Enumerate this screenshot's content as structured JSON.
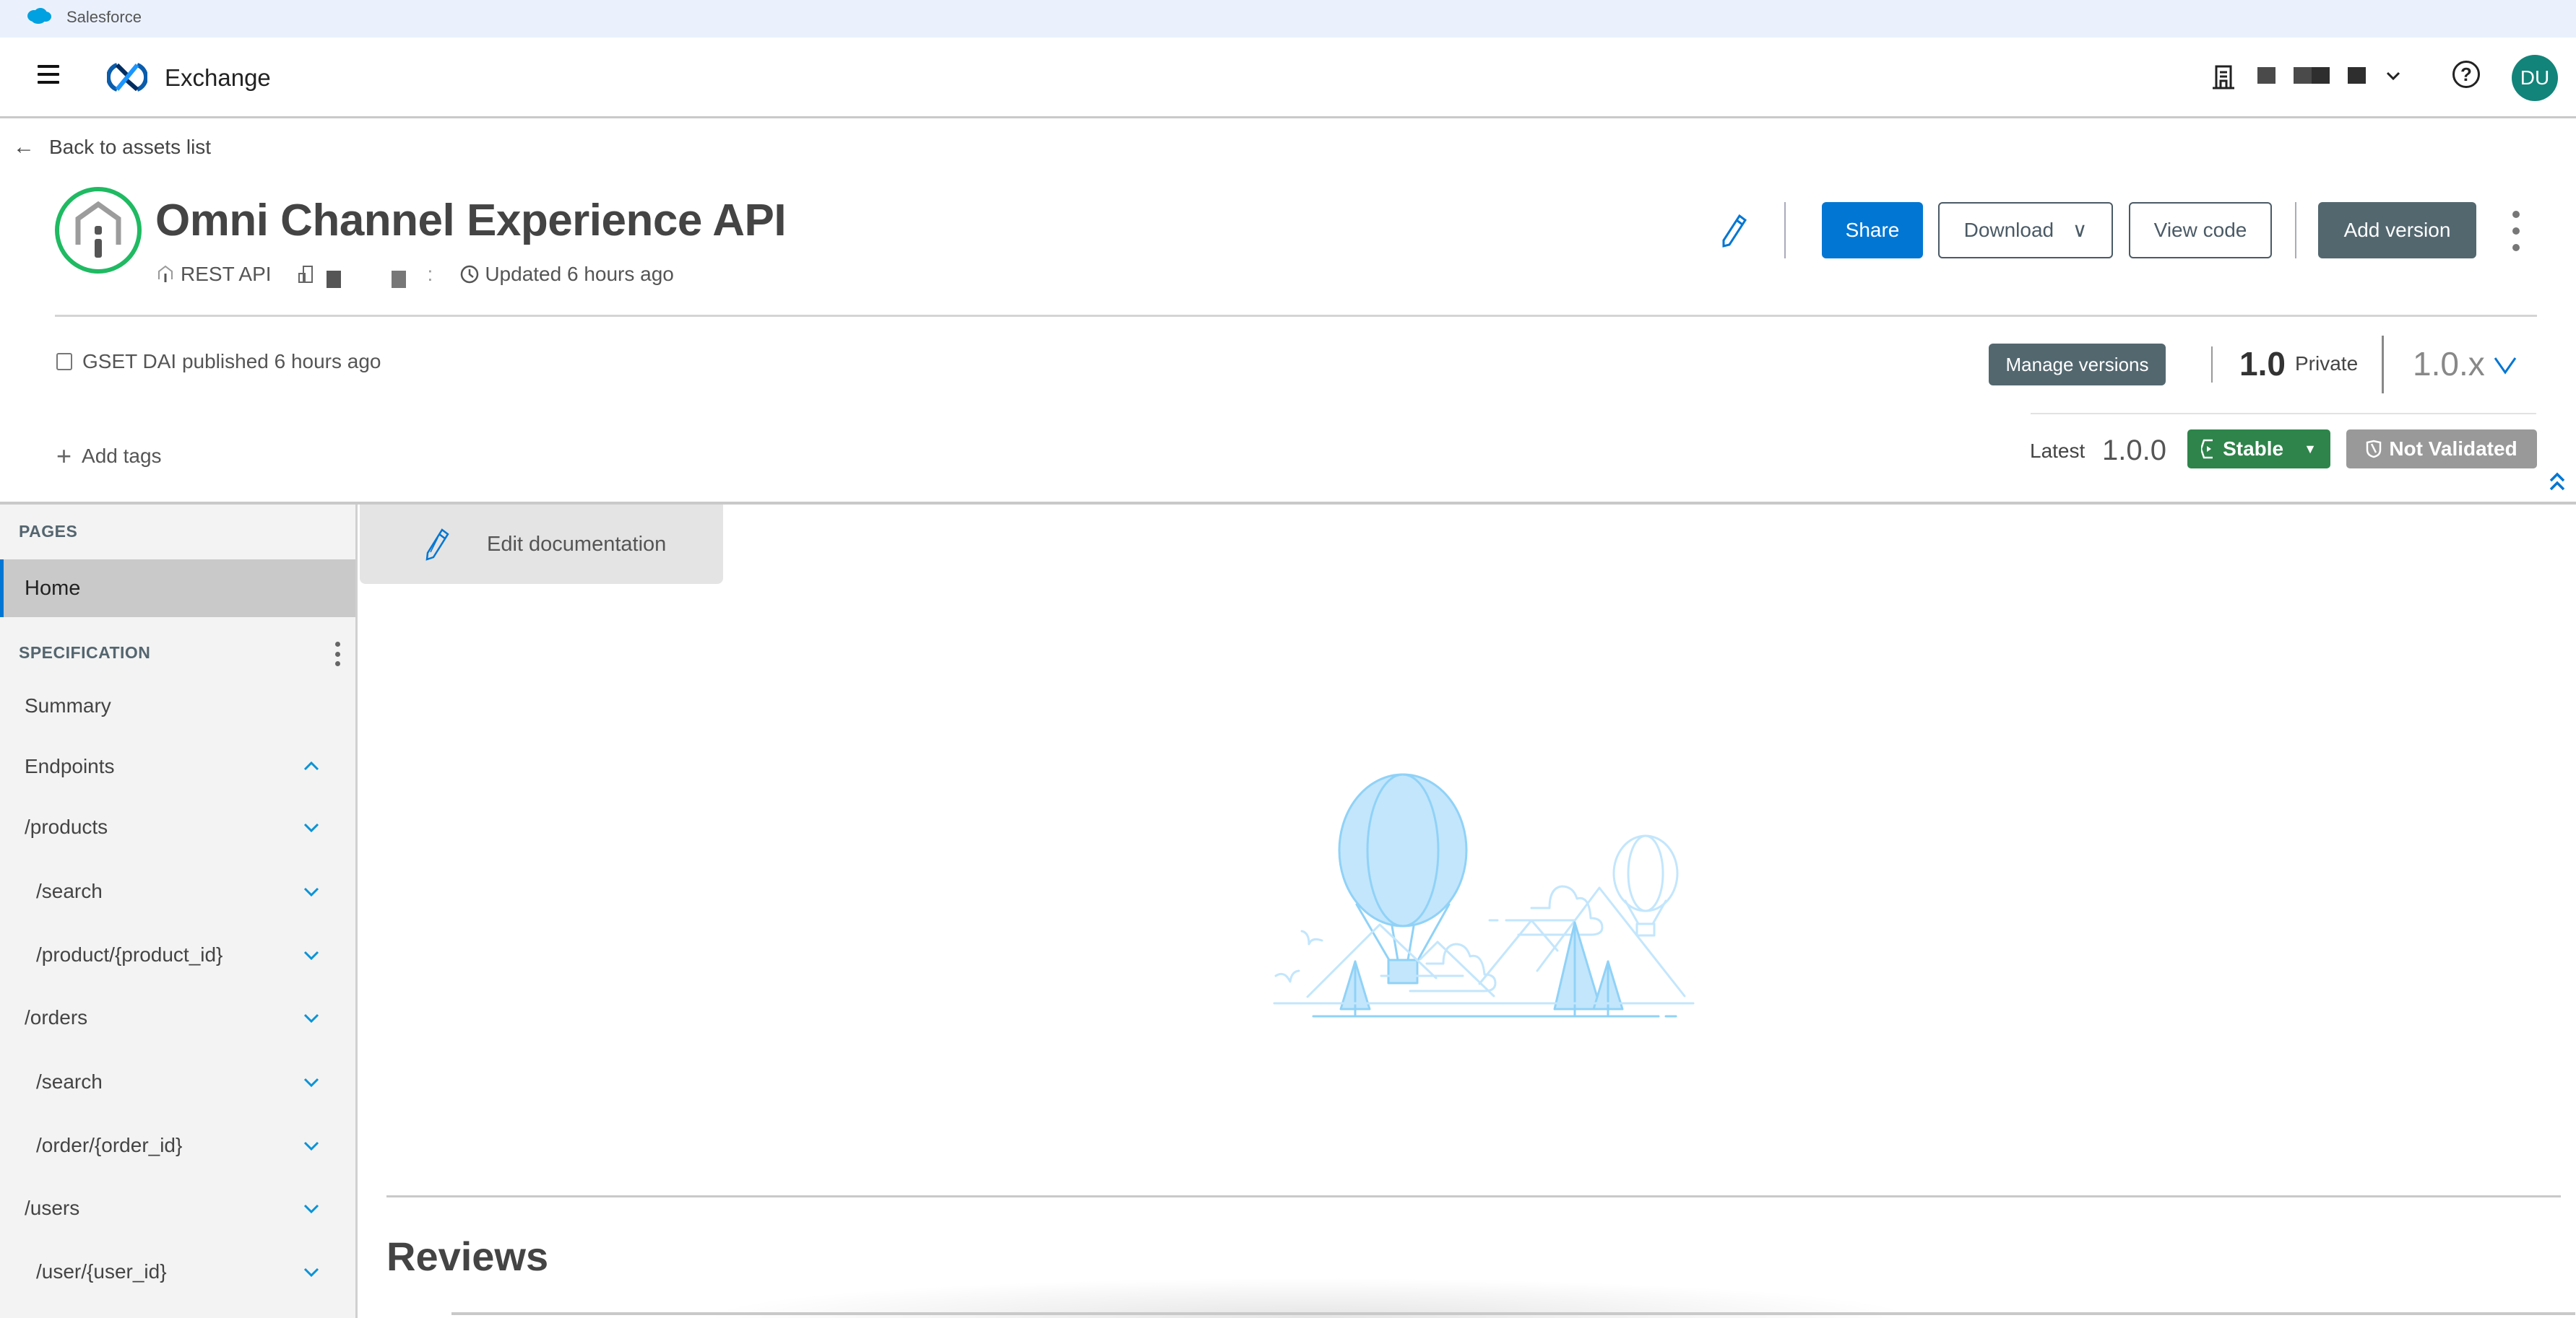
{
  "topbar": {
    "brand": "Salesforce"
  },
  "nav": {
    "app_title": "Exchange",
    "avatar_initials": "DU",
    "icons": {
      "menu": "hamburger-icon",
      "org": "building-icon",
      "help": "help-icon",
      "chevron": "chevron-down-icon"
    }
  },
  "header": {
    "back_label": "Back to assets list",
    "asset_title": "Omni Channel Experience API",
    "asset_type": "REST API",
    "meta_separator": ":",
    "updated": "Updated 6 hours ago",
    "actions": {
      "share": "Share",
      "download": "Download",
      "download_chevron": "∨",
      "view_code": "View code",
      "add_version": "Add version"
    },
    "published": "GSET DAI published 6 hours ago",
    "add_tags": "Add tags",
    "add_tags_icon": "+",
    "manage_versions": "Manage versions",
    "version_major": "1.0",
    "visibility": "Private",
    "version_selector": "1.0.x",
    "latest_label": "Latest",
    "latest_version": "1.0.0",
    "lifecycle_state": "Stable",
    "lifecycle_caret": "▼",
    "validation": "Not Validated",
    "colors": {
      "share": "#0176d3",
      "stable": "#2e844a",
      "not_validated": "#999999",
      "dark_button": "#53676f",
      "asset_ring": "#1fba62",
      "avatar": "#12847a"
    }
  },
  "sidebar": {
    "pages_heading": "PAGES",
    "pages": [
      {
        "label": "Home",
        "active": true
      }
    ],
    "spec_heading": "SPECIFICATION",
    "spec_items": [
      {
        "label": "Summary",
        "level": 0,
        "chevron": "none"
      },
      {
        "label": "Endpoints",
        "level": 0,
        "chevron": "up"
      },
      {
        "label": "/products",
        "level": 0,
        "chevron": "down"
      },
      {
        "label": "/search",
        "level": 1,
        "chevron": "down"
      },
      {
        "label": "/product/{product_id}",
        "level": 1,
        "chevron": "down"
      },
      {
        "label": "/orders",
        "level": 0,
        "chevron": "down"
      },
      {
        "label": "/search",
        "level": 1,
        "chevron": "down"
      },
      {
        "label": "/order/{order_id}",
        "level": 1,
        "chevron": "down"
      },
      {
        "label": "/users",
        "level": 0,
        "chevron": "down"
      },
      {
        "label": "/user/{user_id}",
        "level": 1,
        "chevron": "down"
      }
    ]
  },
  "main": {
    "edit_documentation": "Edit documentation",
    "illustration": "hot-air-balloon-empty-state",
    "reviews_heading": "Reviews"
  }
}
